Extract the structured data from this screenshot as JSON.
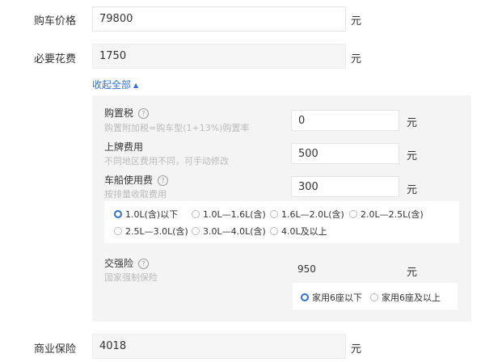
{
  "price": {
    "label": "购车价格",
    "value": "79800",
    "unit": "元"
  },
  "required_cost": {
    "label": "必要花费",
    "value": "1750",
    "unit": "元"
  },
  "collapse_toggle": {
    "label": "收起全部"
  },
  "purchase_tax": {
    "label": "购置税",
    "hint": "购置附加税=购车型(1+13%)购置率",
    "value": "0",
    "unit": "元"
  },
  "plate_fee": {
    "label": "上牌费用",
    "hint": "不同地区费用不同，可手动修改",
    "value": "500",
    "unit": "元"
  },
  "vehicle_tax": {
    "label": "车船使用费",
    "hint": "按排量收取费用",
    "value": "300",
    "unit": "元",
    "options": [
      "1.0L(含)以下",
      "1.0L—1.6L(含)",
      "1.6L—2.0L(含)",
      "2.0L—2.5L(含)",
      "2.5L—3.0L(含)",
      "3.0L—4.0L(含)",
      "4.0L及以上"
    ],
    "selected_index": 0
  },
  "compulsory_insurance": {
    "label": "交强险",
    "hint": "国家强制保险",
    "value": "950",
    "unit": "元",
    "options": [
      "家用6座以下",
      "家用6座及以上"
    ],
    "selected_index": 0
  },
  "commercial_insurance": {
    "label": "商业保险",
    "value": "4018",
    "unit": "元"
  },
  "accent_color": "#2c6fdd"
}
